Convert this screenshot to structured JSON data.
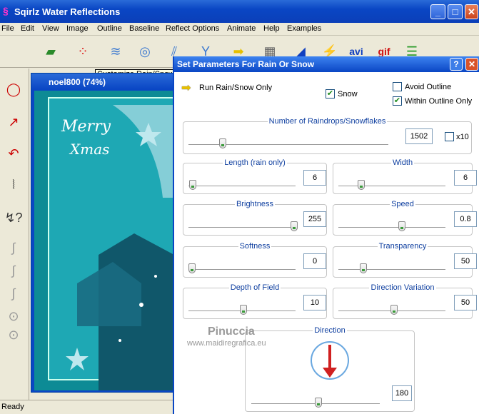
{
  "app": {
    "title": "Sqirlz Water Reflections",
    "icon": "app-icon"
  },
  "menu": [
    "File",
    "Edit",
    "View",
    "Image",
    "Outline",
    "Baseline",
    "Reflect Options",
    "Animate",
    "Help",
    "Examples"
  ],
  "toolbar": {
    "tooltip": "Customize Rain/Snow",
    "icons": [
      "open-folder-icon",
      "rgb-dots-icon",
      "waves-icon",
      "ripples-icon",
      "rain-icon",
      "rain-variant-icon",
      "arrow-right-icon",
      "texture-icon",
      "triangle-icon",
      "lightning-icon",
      "avi-icon",
      "gif-icon",
      "frames-icon"
    ],
    "avi_label": "avi",
    "gif_label": "gif"
  },
  "document": {
    "title": "noel800  (74%)",
    "greeting1": "Merry",
    "greeting2": "Xmas"
  },
  "status": {
    "text": "Ready"
  },
  "dialog": {
    "title": "Set Parameters For Rain Or Snow",
    "run_label": "Run Rain/Snow Only",
    "snow": {
      "label": "Snow",
      "checked": true
    },
    "avoid_outline": {
      "label": "Avoid Outline",
      "checked": false
    },
    "within_outline": {
      "label": "Within Outline Only",
      "checked": true
    },
    "raindrops": {
      "label": "Number of Raindrops/Snowflakes",
      "value": "1502",
      "x10_label": "x10",
      "x10_checked": false
    },
    "length": {
      "label": "Length (rain only)",
      "value": "6"
    },
    "width": {
      "label": "Width",
      "value": "6"
    },
    "brightness": {
      "label": "Brightness",
      "value": "255"
    },
    "speed": {
      "label": "Speed",
      "value": "0.8"
    },
    "softness": {
      "label": "Softness",
      "value": "0"
    },
    "transparency": {
      "label": "Transparency",
      "value": "50"
    },
    "depth": {
      "label": "Depth of Field",
      "value": "10"
    },
    "direction_variation": {
      "label": "Direction Variation",
      "value": "50"
    },
    "direction": {
      "label": "Direction",
      "value": "180"
    }
  },
  "watermark": {
    "name": "Pinuccia",
    "site": "www.maidiregrafica.eu"
  }
}
